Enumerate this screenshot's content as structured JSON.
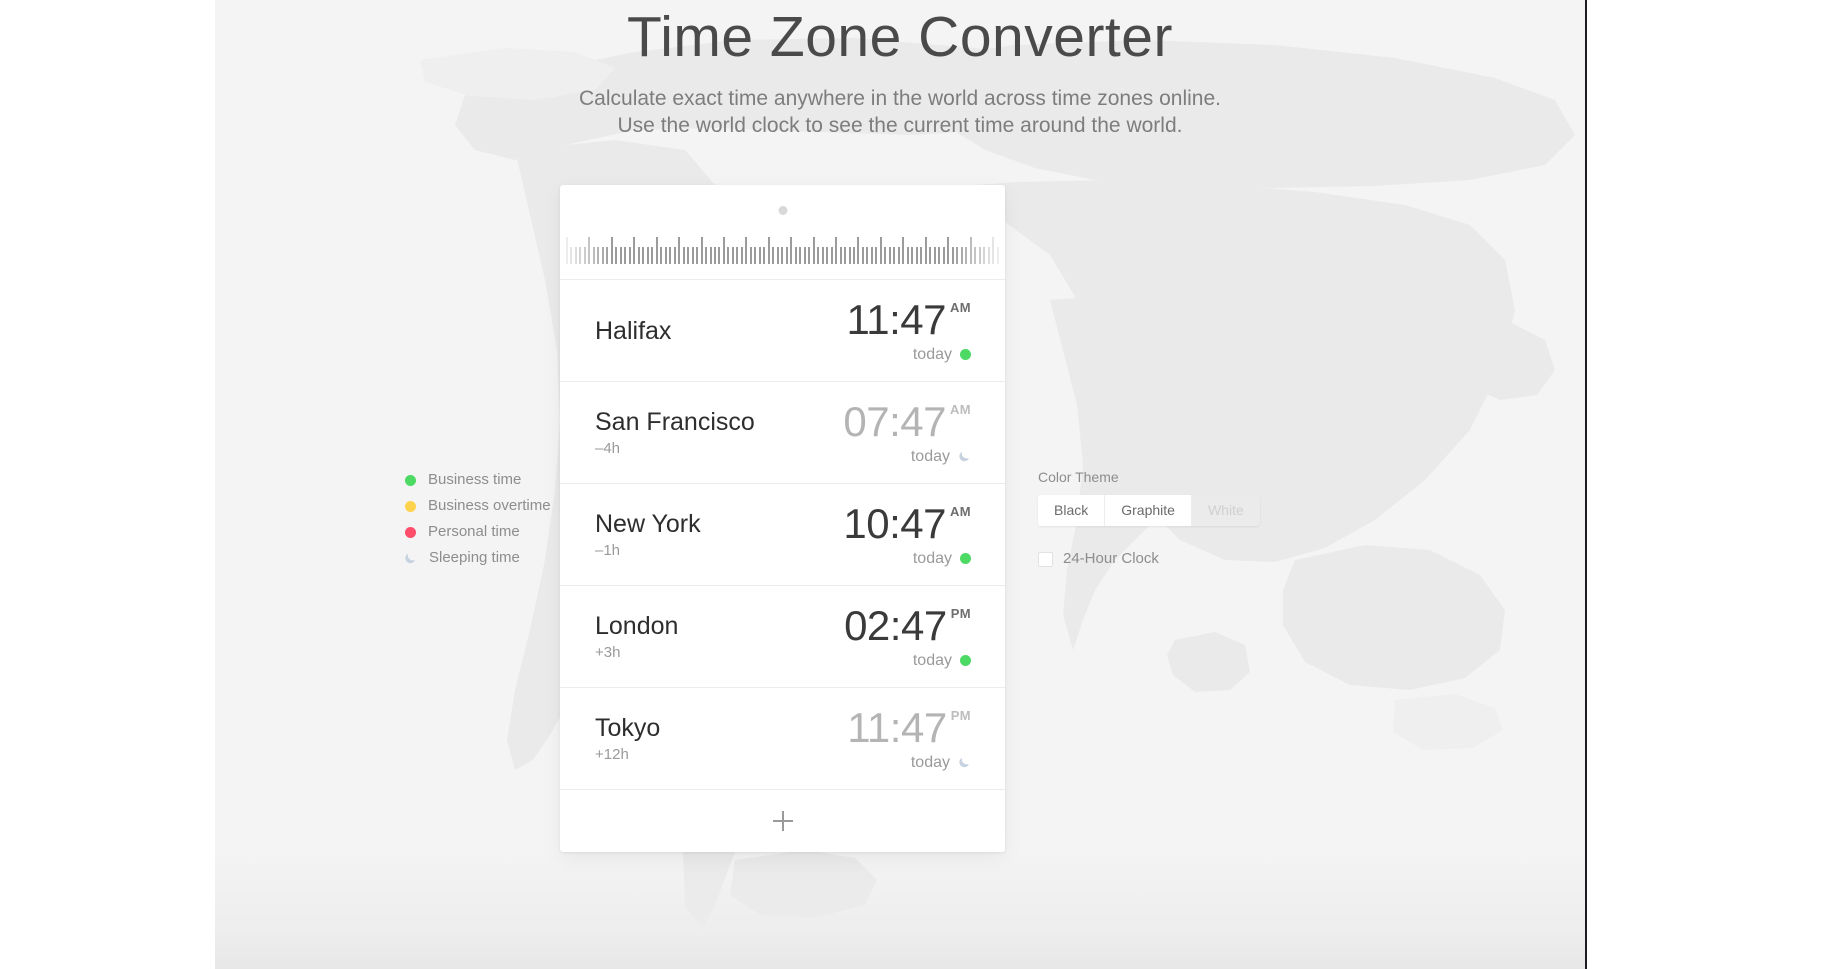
{
  "header": {
    "title": "Time Zone Converter",
    "subtitle_line1": "Calculate exact time anywhere in the world across time zones online.",
    "subtitle_line2": "Use the world clock to see the current time around the world."
  },
  "clock_card": {
    "scrubber": {
      "handle_name": "time-scrubber-handle",
      "tick_count": 97,
      "major_every": 5
    },
    "cities": [
      {
        "name": "Halifax",
        "offset": "",
        "time": "11:47",
        "meridiem": "AM",
        "day": "today",
        "status": "business",
        "status_icon": "green-dot",
        "dim": false
      },
      {
        "name": "San Francisco",
        "offset": "–4h",
        "time": "07:47",
        "meridiem": "AM",
        "day": "today",
        "status": "sleeping",
        "status_icon": "moon-icon",
        "dim": true
      },
      {
        "name": "New York",
        "offset": "–1h",
        "time": "10:47",
        "meridiem": "AM",
        "day": "today",
        "status": "business",
        "status_icon": "green-dot",
        "dim": false
      },
      {
        "name": "London",
        "offset": "+3h",
        "time": "02:47",
        "meridiem": "PM",
        "day": "today",
        "status": "business",
        "status_icon": "green-dot",
        "dim": false
      },
      {
        "name": "Tokyo",
        "offset": "+12h",
        "time": "11:47",
        "meridiem": "PM",
        "day": "today",
        "status": "sleeping",
        "status_icon": "moon-icon",
        "dim": true
      }
    ],
    "add_city": {
      "icon": "plus-icon",
      "label": ""
    }
  },
  "legend": [
    {
      "label": "Business time",
      "icon": "green-dot",
      "color": "#4cd964"
    },
    {
      "label": "Business overtime",
      "icon": "yellow-dot",
      "color": "#ffd24d"
    },
    {
      "label": "Personal time",
      "icon": "red-dot",
      "color": "#ff4d6a"
    },
    {
      "label": "Sleeping time",
      "icon": "moon-icon",
      "color": "#c6d2e0"
    }
  ],
  "settings": {
    "color_theme_label": "Color Theme",
    "themes": [
      {
        "label": "Black",
        "selected": false,
        "disabled": false
      },
      {
        "label": "Graphite",
        "selected": false,
        "disabled": false
      },
      {
        "label": "White",
        "selected": true,
        "disabled": true
      }
    ],
    "clock_24h": {
      "label": "24-Hour Clock",
      "checked": false
    }
  },
  "colors": {
    "status_business": "#4cd964",
    "status_overtime": "#ffd24d",
    "status_personal": "#ff4d6a",
    "status_sleeping": "#c6d2e0",
    "page_background": "#f4f4f4",
    "card_background": "#ffffff",
    "title_text": "#4a4a4a",
    "muted_text": "#8d8d8d"
  }
}
